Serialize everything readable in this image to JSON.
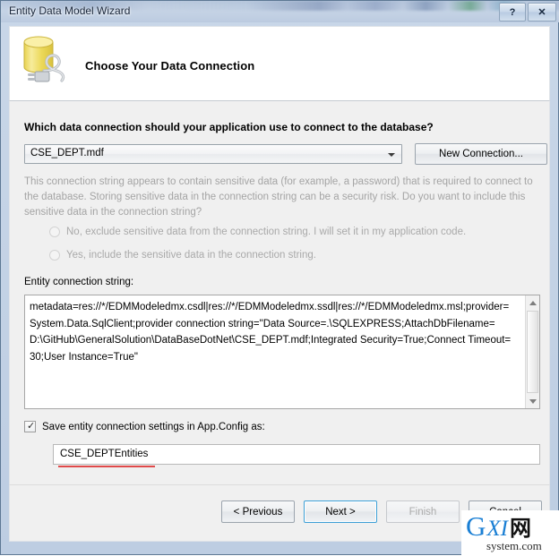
{
  "window": {
    "title": "Entity Data Model Wizard",
    "caption_buttons": [
      {
        "name": "help",
        "glyph": "?"
      },
      {
        "name": "close",
        "glyph": "✕"
      }
    ]
  },
  "header": {
    "icon": "database-connection-icon",
    "heading": "Choose Your Data Connection"
  },
  "main": {
    "question": "Which data connection should your application use to connect to the database?",
    "connection_combo": {
      "value": "CSE_DEPT.mdf",
      "arrow_icon": "chevron-down-icon"
    },
    "new_connection_button": "New Connection...",
    "sensitive_paragraph": "This connection string appears to contain sensitive data (for example, a password) that is required to connect to the database. Storing sensitive data in the connection string can be a security risk. Do you want to include this sensitive data in the connection string?",
    "radio_options": [
      {
        "label": "No, exclude sensitive data from the connection string. I will set it in my application code.",
        "selected": false,
        "disabled": true
      },
      {
        "label": "Yes, include the sensitive data in the connection string.",
        "selected": false,
        "disabled": true
      }
    ],
    "entity_connection_string_label": "Entity connection string:",
    "entity_connection_string": "metadata=res://*/EDMModeledmx.csdl|res://*/EDMModeledmx.ssdl|res://*/EDMModeledmx.msl;provider=System.Data.SqlClient;provider connection string=\"Data Source=.\\SQLEXPRESS;AttachDbFilename=D:\\GitHub\\GeneralSolution\\DataBaseDotNet\\CSE_DEPT.mdf;Integrated Security=True;Connect Timeout=30;User Instance=True\"",
    "save_checkbox": {
      "label": "Save entity connection settings in App.Config as:",
      "checked": true,
      "tick_glyph": "✓"
    },
    "entities_name_value": "CSE_DEPTEntities"
  },
  "footer": {
    "buttons": [
      {
        "label": "< Previous",
        "state": "enabled"
      },
      {
        "label": "Next >",
        "state": "focused"
      },
      {
        "label": "Finish",
        "state": "disabled"
      },
      {
        "label": "Cancel",
        "state": "enabled"
      }
    ]
  },
  "watermark": {
    "g": "G",
    "xi": "XI",
    "cjk": "网",
    "sub": "system.com"
  },
  "colors": {
    "accent_blue": "#1a7fd4",
    "focus_border": "#3c9fd6",
    "red_underline": "#e04a4a",
    "disabled_text": "#a4a4a4"
  }
}
